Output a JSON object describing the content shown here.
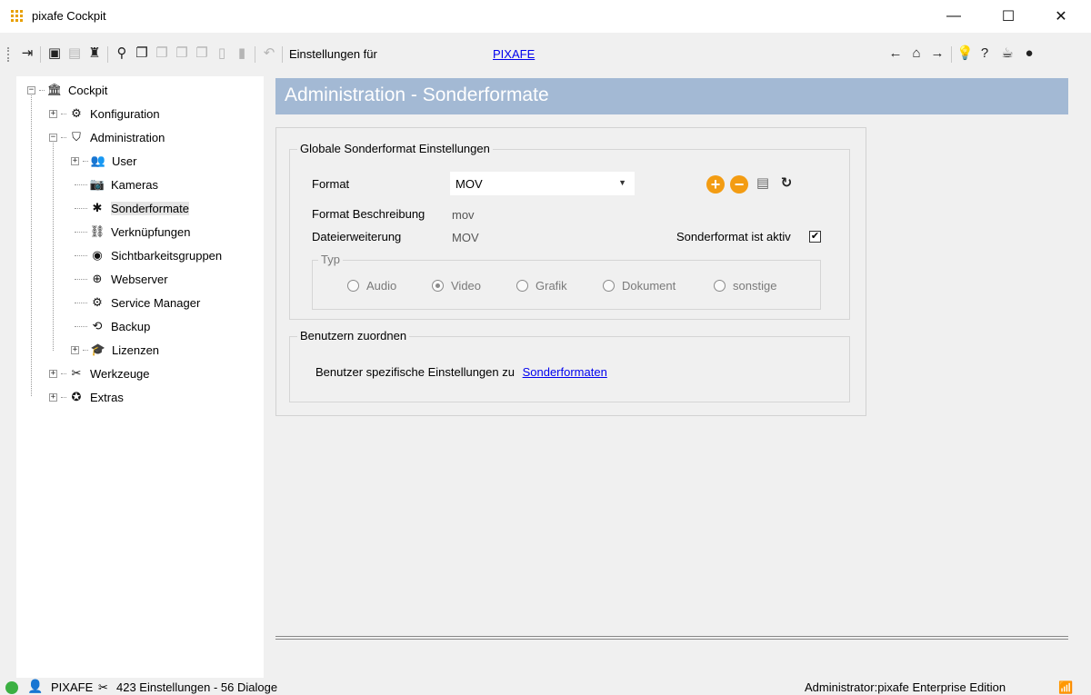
{
  "window": {
    "title": "pixafe Cockpit",
    "minimize_icon": "—",
    "maximize_icon": "☐",
    "close_icon": "✕"
  },
  "toolbar": {
    "label": "Einstellungen für",
    "link": "PIXAFE"
  },
  "tree": {
    "items": [
      {
        "label": "Cockpit"
      },
      {
        "label": "Konfiguration"
      },
      {
        "label": "Administration"
      },
      {
        "label": "User"
      },
      {
        "label": "Kameras"
      },
      {
        "label": "Sonderformate"
      },
      {
        "label": "Verknüpfungen"
      },
      {
        "label": "Sichtbarkeitsgruppen"
      },
      {
        "label": "Webserver"
      },
      {
        "label": "Service Manager"
      },
      {
        "label": "Backup"
      },
      {
        "label": "Lizenzen"
      },
      {
        "label": "Werkzeuge"
      },
      {
        "label": "Extras"
      }
    ]
  },
  "header": {
    "title": "Administration - Sonderformate"
  },
  "global": {
    "legend": "Globale Sonderformat Einstellungen",
    "format_label": "Format",
    "format_value": "MOV",
    "desc_label": "Format Beschreibung",
    "desc_value": "mov",
    "ext_label": "Dateierweiterung",
    "ext_value": "MOV",
    "active_label": "Sonderformat ist aktiv",
    "active_checked": true,
    "typ_legend": "Typ",
    "types": [
      "Audio",
      "Video",
      "Grafik",
      "Dokument",
      "sonstige"
    ],
    "selected_type": "Video"
  },
  "assign": {
    "legend": "Benutzern zuordnen",
    "text": "Benutzer spezifische Einstellungen zu",
    "link": "Sonderformaten"
  },
  "status": {
    "user": "PIXAFE",
    "counts": "423 Einstellungen - 56 Dialoge",
    "right": "Administrator:pixafe  Enterprise Edition"
  },
  "colors": {
    "header_bg": "#a3b9d4",
    "accent": "#f39c12",
    "status_ok": "#3cb043",
    "link": "#0000ee"
  }
}
